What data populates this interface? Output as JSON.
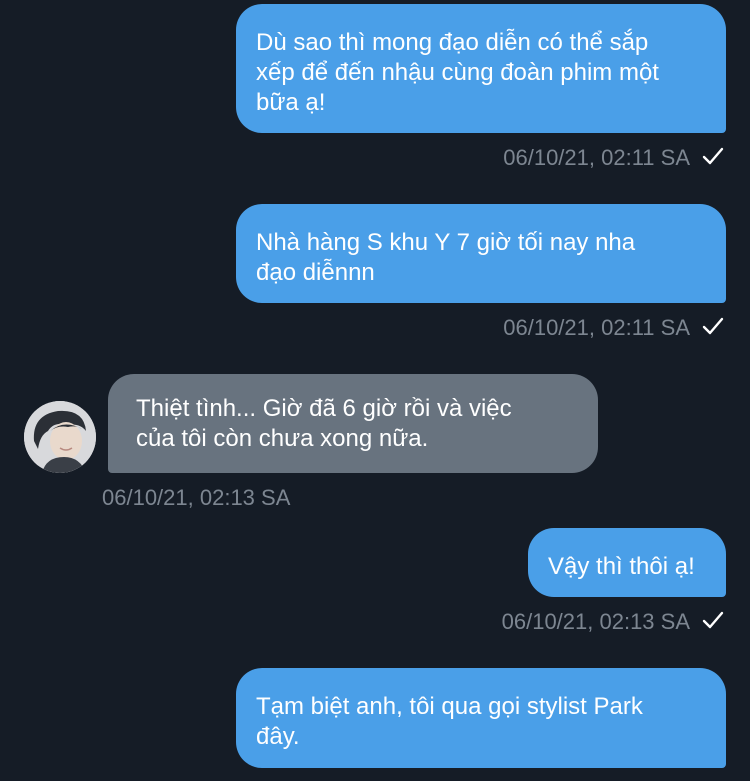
{
  "messages": [
    {
      "text": "Dù sao thì mong đạo diễn có thể sắp\nxếp để đến nhậu cùng đoàn phim một\nbữa ạ!",
      "time": "06/10/21, 02:11 SA"
    },
    {
      "text": "Nhà hàng S khu Y 7 giờ tối nay nha\nđạo diễnnn",
      "time": "06/10/21, 02:11 SA"
    },
    {
      "text": " Thiệt tình... Giờ đã 6 giờ rồi và việc\ncủa tôi còn chưa xong nữa.",
      "time": "06/10/21, 02:13 SA"
    },
    {
      "text": "Vậy thì thôi ạ!",
      "time": "06/10/21, 02:13 SA"
    },
    {
      "text": "Tạm biệt anh, tôi qua gọi stylist Park\nđây."
    }
  ],
  "colors": {
    "background": "#151c26",
    "outgoing_bubble": "#4a9fe8",
    "incoming_bubble": "#68737f",
    "timestamp": "#7d8691"
  },
  "icons": {
    "read_receipt": "checkmark-icon",
    "contact_avatar": "avatar"
  }
}
